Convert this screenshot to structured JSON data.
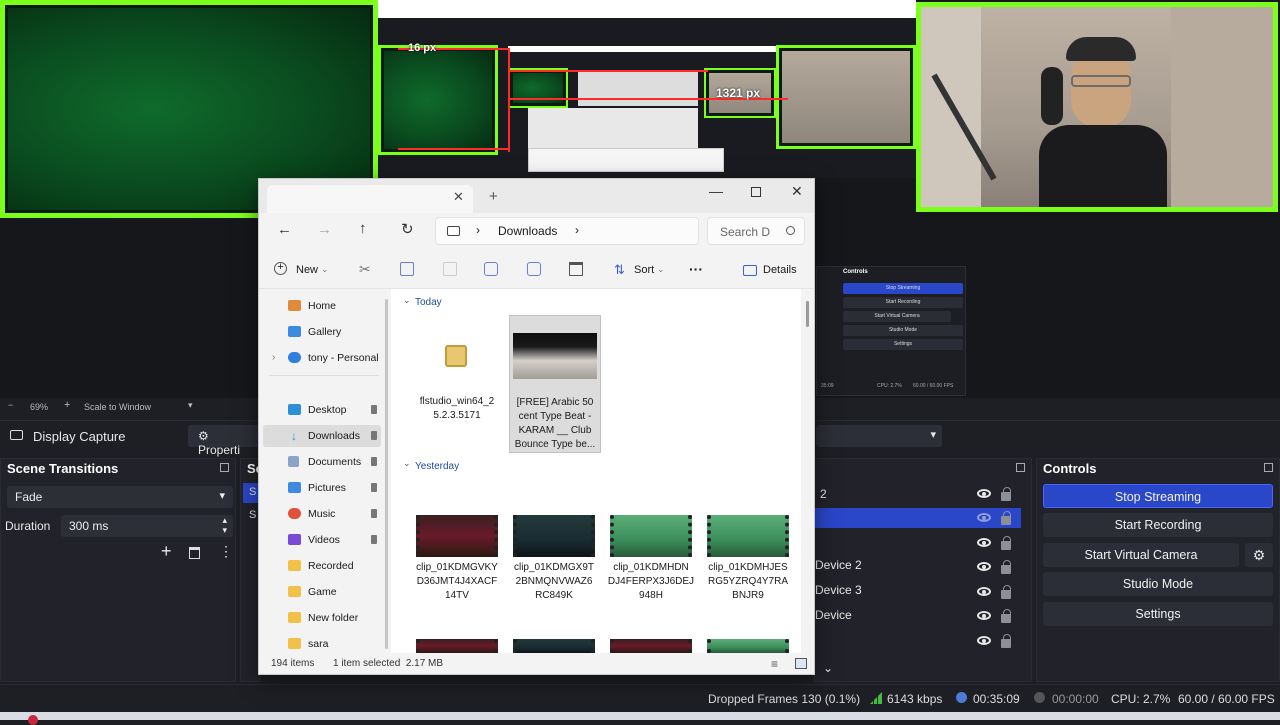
{
  "preview": {
    "measure_left": "16 px",
    "measure_right": "1321 px",
    "zoom": "69%",
    "scale_label": "Scale to Window"
  },
  "mini_controls": {
    "title": "Controls",
    "buttons": [
      "Stop Streaming",
      "Start Recording",
      "Start Virtual Camera",
      "Studio Mode",
      "Settings"
    ],
    "status": "CPU: 2.7%",
    "fps": "60.00 / 60.00 FPS",
    "time": "35:09"
  },
  "sourcebar": {
    "source_name": "Display Capture",
    "properties_label": "Properti"
  },
  "scene_transitions": {
    "title": "Scene Transitions",
    "transition": "Fade",
    "duration_label": "Duration",
    "duration_value": "300 ms"
  },
  "scenes_dock": {
    "title_fragment": "Sc",
    "item_a": "S",
    "item_b": "S"
  },
  "sources_dock": {
    "items": [
      "2",
      "",
      "",
      "Device 2",
      "Device 3",
      "Device",
      ""
    ]
  },
  "controls": {
    "title": "Controls",
    "stop_streaming": "Stop Streaming",
    "start_recording": "Start Recording",
    "start_virtual_camera": "Start Virtual Camera",
    "studio_mode": "Studio Mode",
    "settings": "Settings"
  },
  "status": {
    "dropped_frames": "Dropped Frames 130 (0.1%)",
    "bitrate": "6143 kbps",
    "stream_time": "00:35:09",
    "rec_time": "00:00:00",
    "cpu": "CPU: 2.7%",
    "fps": "60.00 / 60.00 FPS"
  },
  "explorer": {
    "breadcrumb": "Downloads",
    "search_placeholder": "Search D",
    "cmd_new": "New",
    "cmd_sort": "Sort",
    "cmd_more": "···",
    "cmd_details": "Details",
    "nav": {
      "home": "Home",
      "gallery": "Gallery",
      "tony": "tony - Personal",
      "desktop": "Desktop",
      "downloads": "Downloads",
      "documents": "Documents",
      "pictures": "Pictures",
      "music": "Music",
      "videos": "Videos",
      "recorded": "Recorded",
      "game": "Game",
      "new_folder": "New folder",
      "sara": "sara"
    },
    "group_today": "Today",
    "group_yesterday": "Yesterday",
    "today_files": [
      {
        "name": "flstudio_win64_2\n5.2.3.5171"
      },
      {
        "name": "[FREE] Arabic 50\ncent Type Beat -\nKARAM __ Club\nBounce Type be..."
      }
    ],
    "yesterday_files": [
      {
        "name": "clip_01KDMGVKY\nD36JMT4J4XACF\n14TV"
      },
      {
        "name": "clip_01KDMGX9T\n2BNMQNVWAZ6\nRC849K"
      },
      {
        "name": "clip_01KDMHDN\nDJ4FERPX3J6DEJ\n948H"
      },
      {
        "name": "clip_01KDMHJES\nRG5YZRQ4Y7RA\nBNJR9"
      }
    ],
    "item_count": "194 items",
    "selection": "1 item selected  2.17 MB"
  }
}
